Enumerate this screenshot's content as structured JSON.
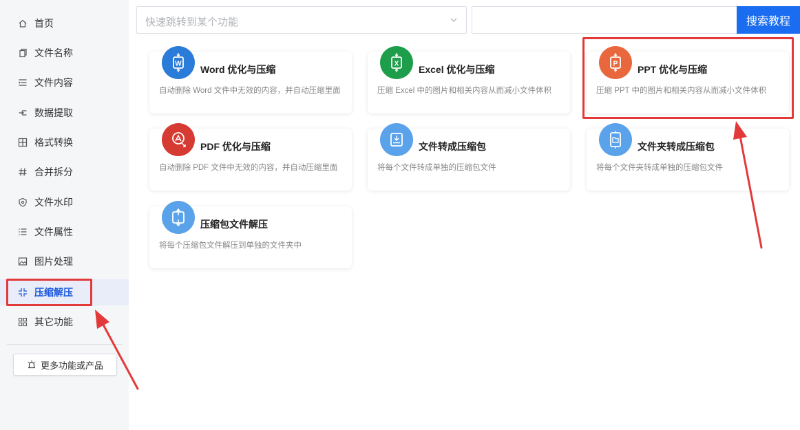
{
  "sidebar": {
    "items": [
      {
        "label": "首页",
        "icon": "home-icon"
      },
      {
        "label": "文件名称",
        "icon": "file-copy-icon"
      },
      {
        "label": "文件内容",
        "icon": "content-lines-icon"
      },
      {
        "label": "数据提取",
        "icon": "extract-icon"
      },
      {
        "label": "格式转换",
        "icon": "convert-grid-icon"
      },
      {
        "label": "合并拆分",
        "icon": "hash-icon"
      },
      {
        "label": "文件水印",
        "icon": "shield-icon"
      },
      {
        "label": "文件属性",
        "icon": "list-icon"
      },
      {
        "label": "图片处理",
        "icon": "image-icon"
      },
      {
        "label": "压缩解压",
        "icon": "compress-icon",
        "active": true
      },
      {
        "label": "其它功能",
        "icon": "apps-grid-icon"
      }
    ],
    "more_button": "更多功能或产品"
  },
  "topbar": {
    "jump_placeholder": "快速跳转到某个功能",
    "search_value": "",
    "search_button": "搜索教程"
  },
  "cards": [
    {
      "title": "Word 优化与压缩",
      "desc": "自动删除 Word 文件中无效的内容，并自动压缩里面",
      "icon": "word-compress-icon",
      "color": "#2b7bd8"
    },
    {
      "title": "Excel 优化与压缩",
      "desc": "压缩 Excel 中的图片和相关内容从而减小文件体积",
      "icon": "excel-compress-icon",
      "color": "#1e9e4a"
    },
    {
      "title": "PPT 优化与压缩",
      "desc": "压缩 PPT 中的图片和相关内容从而减小文件体积",
      "icon": "ppt-compress-icon",
      "color": "#e8673c"
    },
    {
      "title": "PDF 优化与压缩",
      "desc": "自动删除 PDF 文件中无效的内容，并自动压缩里面",
      "icon": "pdf-compress-icon",
      "color": "#d63b33"
    },
    {
      "title": "文件转成压缩包",
      "desc": "将每个文件转成单独的压缩包文件",
      "icon": "file-to-archive-icon",
      "color": "#5aa2ea"
    },
    {
      "title": "文件夹转成压缩包",
      "desc": "将每个文件夹转成单独的压缩包文件",
      "icon": "folder-to-archive-icon",
      "color": "#5aa2ea"
    },
    {
      "title": "压缩包文件解压",
      "desc": "将每个压缩包文件解压到单独的文件夹中",
      "icon": "extract-archive-icon",
      "color": "#5aa2ea"
    }
  ],
  "annotation_color": "#e23a3a"
}
